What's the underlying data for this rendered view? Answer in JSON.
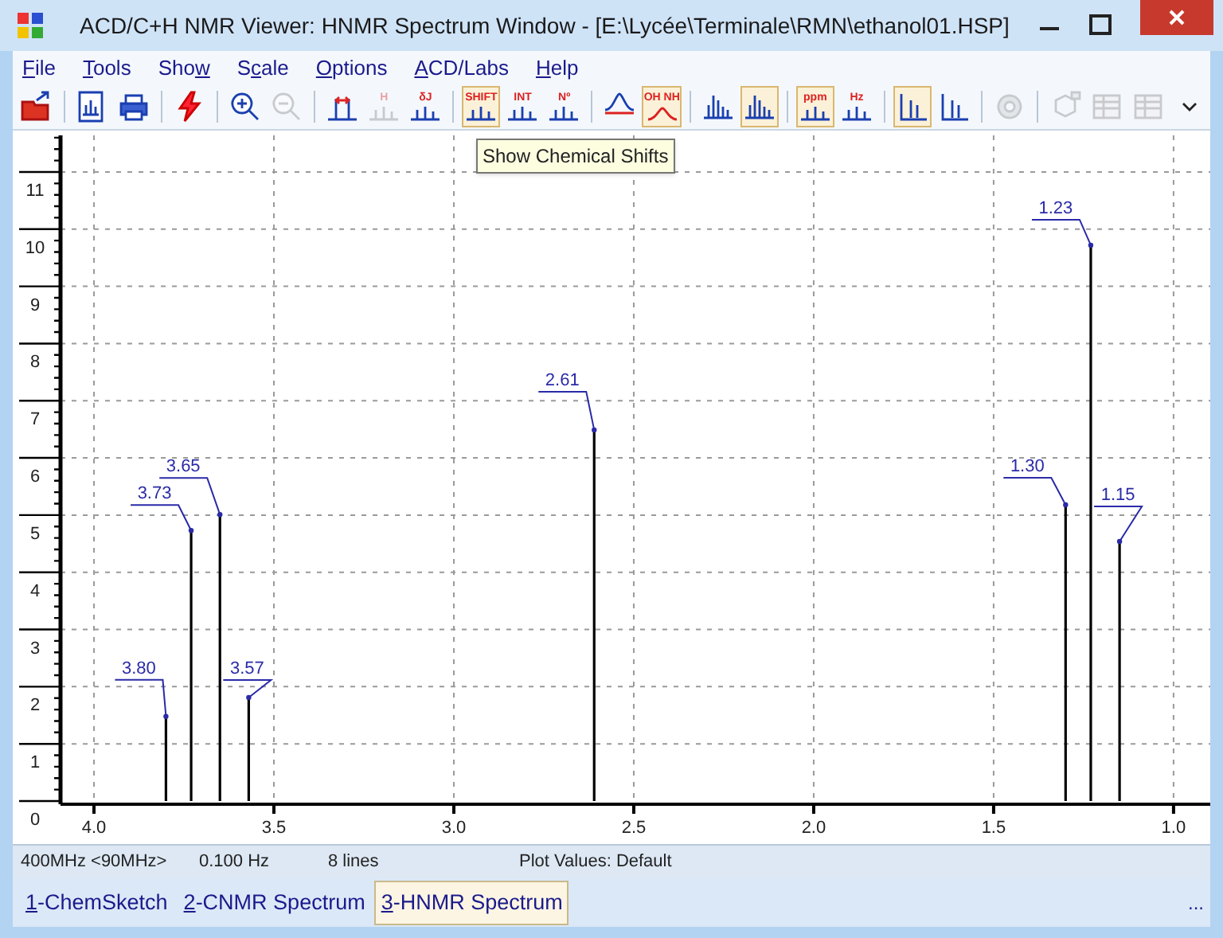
{
  "window": {
    "title": "ACD/C+H NMR Viewer: HNMR Spectrum Window - [E:\\Lycée\\Terminale\\RMN\\ethanol01.HSP]"
  },
  "menu": [
    {
      "access_key": "F",
      "label_after": "ile"
    },
    {
      "access_key": "T",
      "label_after": "ools"
    },
    {
      "label_before": "Sho",
      "access_key": "w"
    },
    {
      "label_before": "S",
      "access_key": "c",
      "label_after": "ale"
    },
    {
      "access_key": "O",
      "label_after": "ptions"
    },
    {
      "access_key": "A",
      "label_after": "CD/Labs"
    },
    {
      "access_key": "H",
      "label_after": "elp"
    }
  ],
  "toolbar": [
    {
      "buttons": [
        {
          "kind": "open",
          "pressed": false,
          "disabled": false
        }
      ]
    },
    {
      "buttons": [
        {
          "kind": "document",
          "pressed": false,
          "disabled": false
        },
        {
          "kind": "printer",
          "pressed": false,
          "disabled": false
        }
      ]
    },
    {
      "buttons": [
        {
          "kind": "lightning",
          "pressed": false,
          "disabled": false
        }
      ]
    },
    {
      "buttons": [
        {
          "kind": "zoom_in",
          "pressed": false,
          "disabled": false
        },
        {
          "kind": "zoom_out",
          "pressed": false,
          "disabled": true
        }
      ]
    },
    {
      "buttons": [
        {
          "kind": "peak_width",
          "pressed": false,
          "disabled": false
        },
        {
          "kind": "labeled",
          "label": "H",
          "pressed": false,
          "disabled": true
        },
        {
          "kind": "labeled",
          "label": "δJ",
          "pressed": false,
          "disabled": false
        }
      ]
    },
    {
      "buttons": [
        {
          "kind": "labeled",
          "label": "SHIFT",
          "pressed": true,
          "disabled": false
        },
        {
          "kind": "labeled",
          "label": "INT",
          "pressed": false,
          "disabled": false
        },
        {
          "kind": "labeled",
          "label": "Nº",
          "pressed": false,
          "disabled": false
        }
      ]
    },
    {
      "buttons": [
        {
          "kind": "baseline",
          "pressed": false,
          "disabled": false
        },
        {
          "kind": "exchange",
          "label": "OH NH",
          "pressed": true,
          "disabled": false
        }
      ]
    },
    {
      "buttons": [
        {
          "kind": "multiplet",
          "pressed": false,
          "disabled": false
        },
        {
          "kind": "multiplet",
          "pressed": true,
          "disabled": false
        }
      ]
    },
    {
      "buttons": [
        {
          "kind": "unit",
          "label": "ppm",
          "pressed": true,
          "disabled": false
        },
        {
          "kind": "unit",
          "label": "Hz",
          "pressed": false,
          "disabled": false
        }
      ]
    },
    {
      "buttons": [
        {
          "kind": "axis",
          "pressed": true,
          "disabled": false
        },
        {
          "kind": "axis",
          "pressed": false,
          "disabled": false
        }
      ]
    },
    {
      "buttons": [
        {
          "kind": "gear",
          "pressed": false,
          "disabled": true
        }
      ]
    },
    {
      "buttons": [
        {
          "kind": "structure",
          "pressed": false,
          "disabled": true
        },
        {
          "kind": "table",
          "pressed": false,
          "disabled": true
        },
        {
          "kind": "table",
          "pressed": false,
          "disabled": true
        },
        {
          "kind": "overflow",
          "pressed": false,
          "disabled": false
        }
      ]
    }
  ],
  "tooltip": {
    "text": "Show Chemical Shifts"
  },
  "spectrum": {
    "chart_data": {
      "type": "bar",
      "xlabel": null,
      "x": [
        3.8,
        3.73,
        3.65,
        3.57,
        2.61,
        1.3,
        1.23,
        1.15
      ],
      "values": [
        1.48,
        4.73,
        5.01,
        1.81,
        6.49,
        5.18,
        9.72,
        4.54
      ],
      "grid": true,
      "xlim": [
        4.093,
        0.898
      ],
      "ylim": [
        0,
        11.64
      ],
      "xticks": [
        {
          "value": 4.0,
          "label": "4.0"
        },
        {
          "value": 3.5,
          "label": "3.5"
        },
        {
          "value": 3.0,
          "label": "3.0"
        },
        {
          "value": 2.5,
          "label": "2.5"
        },
        {
          "value": 2.0,
          "label": "2.0"
        },
        {
          "value": 1.5,
          "label": "1.5"
        },
        {
          "value": 1.0,
          "label": "1.0"
        }
      ],
      "yticks": [
        0,
        1,
        2,
        3,
        4,
        5,
        6,
        7,
        8,
        9,
        10,
        11
      ],
      "annotations": [
        "3.80",
        "3.73",
        "3.65",
        "3.57",
        "2.61",
        "1.30",
        "1.23",
        "1.15"
      ]
    }
  },
  "status_bar": [
    "400MHz <90MHz>",
    "0.100 Hz",
    "8 lines",
    "Plot Values: Default"
  ],
  "tabs": [
    {
      "access_key": "1",
      "label_after": "-ChemSketch",
      "selected": false
    },
    {
      "access_key": "2",
      "label_after": "-CNMR Spectrum",
      "selected": false
    },
    {
      "access_key": "3",
      "label_after": "-HNMR Spectrum",
      "selected": true
    }
  ],
  "tabs_overflow": "..."
}
